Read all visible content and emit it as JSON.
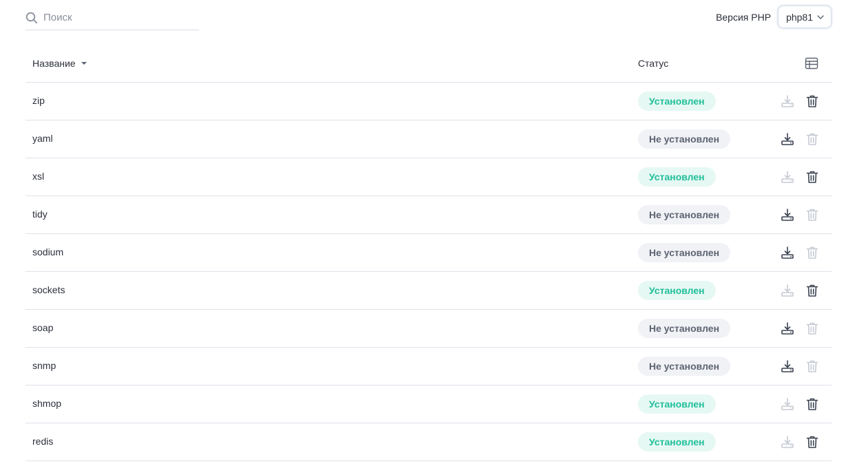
{
  "search": {
    "placeholder": "Поиск"
  },
  "php_version": {
    "label": "Версия PHP",
    "selected": "php81"
  },
  "table": {
    "columns": {
      "name": "Название",
      "status": "Статус"
    },
    "rows": [
      {
        "name": "zip",
        "status": "Установлен",
        "installed": true
      },
      {
        "name": "yaml",
        "status": "Не установлен",
        "installed": false
      },
      {
        "name": "xsl",
        "status": "Установлен",
        "installed": true
      },
      {
        "name": "tidy",
        "status": "Не установлен",
        "installed": false
      },
      {
        "name": "sodium",
        "status": "Не установлен",
        "installed": false
      },
      {
        "name": "sockets",
        "status": "Установлен",
        "installed": true
      },
      {
        "name": "soap",
        "status": "Не установлен",
        "installed": false
      },
      {
        "name": "snmp",
        "status": "Не установлен",
        "installed": false
      },
      {
        "name": "shmop",
        "status": "Установлен",
        "installed": true
      },
      {
        "name": "redis",
        "status": "Установлен",
        "installed": true
      }
    ]
  },
  "icons": {
    "search": "search-icon",
    "dropdown": "chevron-down-icon",
    "sort": "sort-desc-icon",
    "table_settings": "table-settings-icon",
    "install": "install-icon",
    "delete": "trash-icon"
  },
  "colors": {
    "installed_text": "#1fbf9a",
    "installed_bg": "#e6f8f3",
    "not_installed_text": "#5d6371",
    "not_installed_bg": "#f0f2f6",
    "icon_active": "#3a4150",
    "icon_disabled": "#c6cad3"
  }
}
